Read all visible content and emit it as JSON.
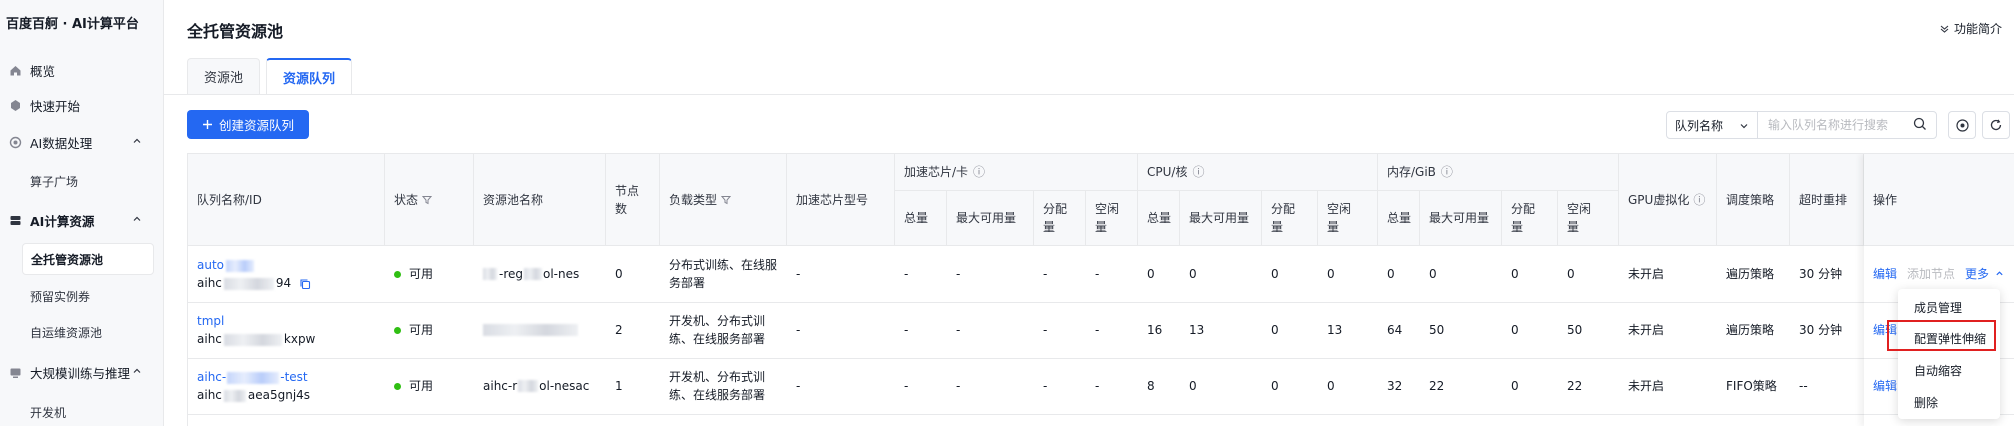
{
  "brand": "百度百舸 · AI计算平台",
  "sidebar": {
    "items": [
      {
        "label": "概览",
        "icon": "home-icon"
      },
      {
        "label": "快速开始",
        "icon": "rocket-icon"
      },
      {
        "label": "AI数据处理",
        "icon": "data-icon",
        "expandable": true
      },
      {
        "label": "算子广场",
        "sub": true
      },
      {
        "label": "AI计算资源",
        "icon": "server-icon",
        "expandable": true
      },
      {
        "label": "全托管资源池",
        "sub": true,
        "active": true
      },
      {
        "label": "预留实例券",
        "sub": true
      },
      {
        "label": "自运维资源池",
        "sub": true
      },
      {
        "label": "大规模训练与推理",
        "icon": "train-icon",
        "expandable": true
      },
      {
        "label": "开发机",
        "sub": true
      }
    ]
  },
  "header": {
    "title": "全托管资源池",
    "feature_guide": "功能简介"
  },
  "tabs": [
    {
      "label": "资源池",
      "active": false
    },
    {
      "label": "资源队列",
      "active": true
    }
  ],
  "toolbar": {
    "create_label": "创建资源队列",
    "filter_select": "队列名称",
    "search_placeholder": "输入队列名称进行搜索"
  },
  "table": {
    "headers": {
      "queue_name": "队列名称/ID",
      "status": "状态",
      "pool_name": "资源池名称",
      "node_count": "节点数",
      "load_type": "负载类型",
      "chip_model": "加速芯片型号",
      "chip_group": "加速芯片/卡",
      "cpu_group": "CPU/核",
      "mem_group": "内存/GiB",
      "total": "总量",
      "max_available": "最大可用量",
      "allocated": "分配量",
      "idle": "空闲量",
      "gpu_virt": "GPU虚拟化",
      "schedule": "调度策略",
      "timeout_requeue": "超时重排",
      "ops": "操作"
    },
    "rows": [
      {
        "name": "auto",
        "id": "aihc",
        "id_suffix": "94",
        "status": "可用",
        "pool": "-reg",
        "pool_suffix": "ol-nes",
        "nodes": "0",
        "load": "分布式训练、在线服务部署",
        "chip_model": "-",
        "chip": [
          "-",
          "-",
          "-",
          "-"
        ],
        "cpu": [
          "0",
          "0",
          "0",
          "0"
        ],
        "mem": [
          "0",
          "0",
          "0",
          "0"
        ],
        "gpu_virt": "未开启",
        "schedule": "遍历策略",
        "timeout": "30 分钟"
      },
      {
        "name": "tmpl",
        "id": "aihc",
        "id_suffix": "kxpw",
        "status": "可用",
        "pool": "",
        "pool_suffix": "",
        "nodes": "2",
        "load": "开发机、分布式训练、在线服务部署",
        "chip_model": "-",
        "chip": [
          "-",
          "-",
          "-",
          "-"
        ],
        "cpu": [
          "16",
          "13",
          "0",
          "13"
        ],
        "mem": [
          "64",
          "50",
          "0",
          "50"
        ],
        "gpu_virt": "未开启",
        "schedule": "遍历策略",
        "timeout": "30 分钟"
      },
      {
        "name": "aihc-",
        "name_suffix": "-test",
        "id": "aihc",
        "id_suffix": "aea5gnj4s",
        "status": "可用",
        "pool": "aihc-r",
        "pool_suffix": "ol-nesac",
        "nodes": "1",
        "load": "开发机、分布式训练、在线服务部署",
        "chip_model": "-",
        "chip": [
          "-",
          "-",
          "-",
          "-"
        ],
        "cpu": [
          "8",
          "0",
          "0",
          "0"
        ],
        "mem": [
          "32",
          "22",
          "0",
          "22"
        ],
        "gpu_virt": "未开启",
        "schedule": "FIFO策略",
        "timeout": "--"
      }
    ],
    "row_actions": {
      "edit": "编辑",
      "add_node": "添加节点",
      "more": "更多"
    }
  },
  "more_menu": {
    "items": [
      "成员管理",
      "配置弹性伸缩",
      "自动缩容",
      "删除"
    ],
    "highlighted": "配置弹性伸缩"
  },
  "colors": {
    "primary": "#2468f2",
    "status_available": "#30bf13",
    "highlight_box": "#e02020"
  }
}
